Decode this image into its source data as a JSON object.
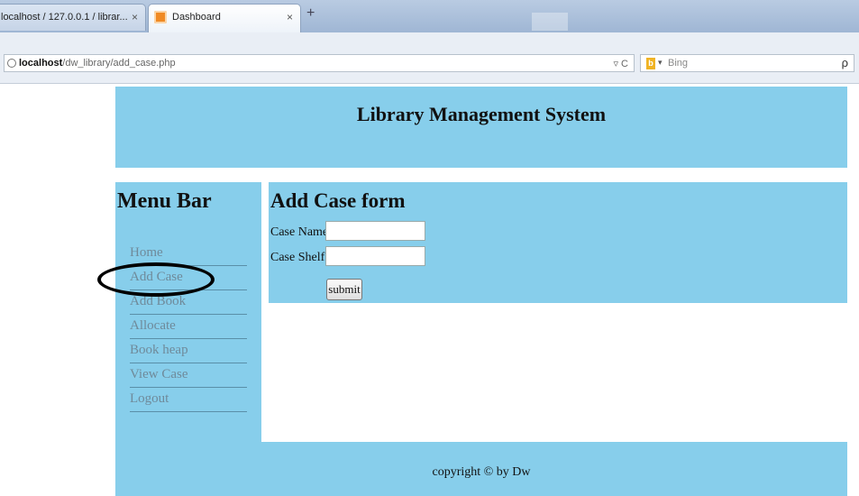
{
  "browser": {
    "tabs": [
      {
        "label": "localhost / 127.0.0.1 / librar...",
        "close": "×"
      },
      {
        "label": "Dashboard",
        "close": "×"
      }
    ],
    "new_tab": "+",
    "url": {
      "domain": "localhost",
      "path": "/dw_library/add_case.php"
    },
    "url_controls": "▿ C",
    "search": {
      "placeholder": "Bing",
      "engine_icon": "bing-icon",
      "caret": "▾"
    },
    "search_icon": "ρ"
  },
  "header": {
    "title": "Library Management System"
  },
  "sidebar": {
    "title": "Menu Bar",
    "items": [
      {
        "label": "Home"
      },
      {
        "label": "Add Case"
      },
      {
        "label": "Add Book"
      },
      {
        "label": "Allocate"
      },
      {
        "label": "Book heap"
      },
      {
        "label": "View Case"
      },
      {
        "label": "Logout"
      }
    ]
  },
  "form": {
    "title": "Add Case form",
    "case_name_label": "Case Name",
    "case_name_value": "",
    "case_shelf_label": "Case Shelf",
    "case_shelf_value": "",
    "submit_label": "submit"
  },
  "footer": {
    "text": "copyright © by Dw"
  },
  "colors": {
    "panel": "#87ceeb",
    "menu_text": "#6f8a9a",
    "annotation": "#000000"
  }
}
